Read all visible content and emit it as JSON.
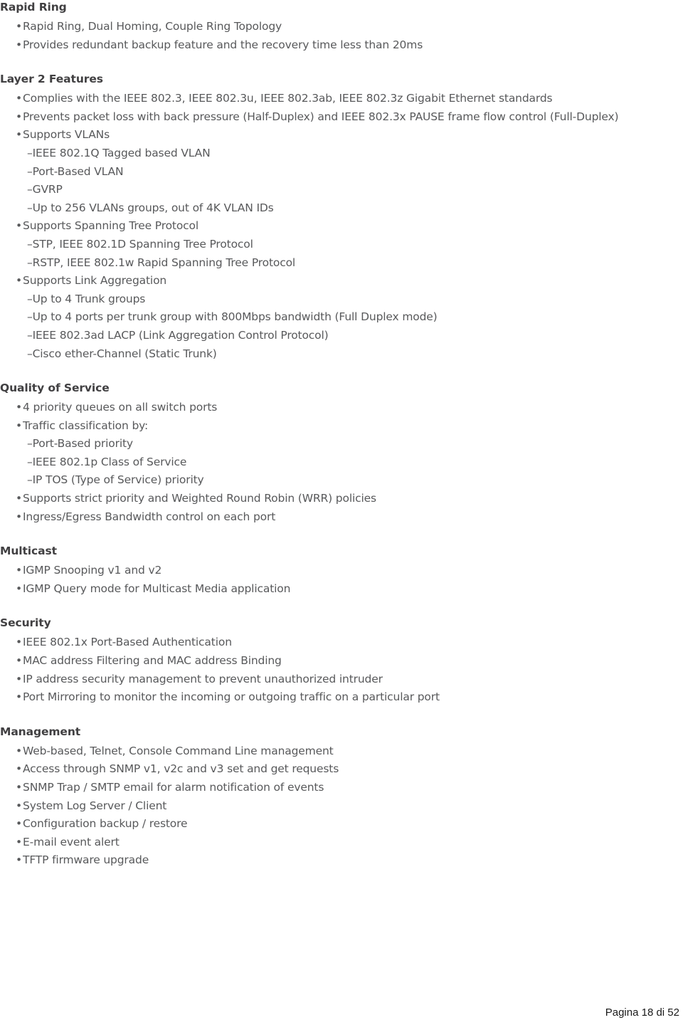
{
  "page": {
    "background_color": "#ffffff",
    "heading_color": "#414042",
    "body_color": "#58595b",
    "footer_color": "#1a1a1a",
    "bullet_glyph": "•",
    "subitem_dash": "–"
  },
  "sections": [
    {
      "heading": "Rapid Ring",
      "items": [
        {
          "text": "Rapid Ring, Dual Homing, Couple Ring Topology",
          "subitems": []
        },
        {
          "text": "Provides redundant backup feature and the recovery time less than 20ms",
          "subitems": []
        }
      ]
    },
    {
      "heading": "Layer 2 Features",
      "items": [
        {
          "text": "Complies with the IEEE 802.3, IEEE 802.3u, IEEE 802.3ab, IEEE 802.3z Gigabit Ethernet standards",
          "subitems": []
        },
        {
          "text": "Prevents packet loss with back pressure (Half-Duplex) and IEEE 802.3x PAUSE frame flow control (Full-Duplex)",
          "subitems": []
        },
        {
          "text": "Supports VLANs",
          "subitems": [
            "–IEEE 802.1Q Tagged based VLAN",
            "–Port-Based VLAN",
            "–GVRP",
            "–Up to 256 VLANs groups, out of 4K VLAN IDs"
          ]
        },
        {
          "text": "Supports Spanning Tree Protocol",
          "subitems": [
            "–STP, IEEE 802.1D Spanning Tree Protocol",
            "–RSTP, IEEE 802.1w Rapid Spanning Tree Protocol"
          ]
        },
        {
          "text": "Supports Link Aggregation",
          "subitems": [
            "–Up to 4 Trunk groups",
            "–Up to 4 ports per trunk group with 800Mbps bandwidth (Full Duplex mode)",
            "–IEEE 802.3ad LACP (Link Aggregation Control Protocol)",
            "–Cisco ether-Channel (Static Trunk)"
          ]
        }
      ]
    },
    {
      "heading": "Quality of Service",
      "items": [
        {
          "text": "4 priority queues on all switch ports",
          "subitems": []
        },
        {
          "text": "Traffic classification by:",
          "subitems": [
            "–Port-Based priority",
            "–IEEE 802.1p Class of Service",
            "–IP TOS (Type of Service) priority"
          ]
        },
        {
          "text": "Supports strict priority and Weighted Round Robin (WRR) policies",
          "subitems": []
        },
        {
          "text": "Ingress/Egress Bandwidth control on each port",
          "subitems": []
        }
      ]
    },
    {
      "heading": "Multicast",
      "items": [
        {
          "text": "IGMP Snooping v1 and v2",
          "subitems": []
        },
        {
          "text": "IGMP Query mode for Multicast Media application",
          "subitems": []
        }
      ]
    },
    {
      "heading": "Security",
      "items": [
        {
          "text": "IEEE 802.1x Port-Based Authentication",
          "subitems": []
        },
        {
          "text": "MAC address Filtering and MAC address Binding",
          "subitems": []
        },
        {
          "text": "IP address security management to prevent unauthorized intruder",
          "subitems": []
        },
        {
          "text": "Port Mirroring to monitor the incoming or outgoing traffic on a particular port",
          "subitems": []
        }
      ]
    },
    {
      "heading": "Management",
      "items": [
        {
          "text": "Web-based, Telnet, Console Command Line management",
          "subitems": []
        },
        {
          "text": "Access through SNMP v1, v2c and v3 set and get requests",
          "subitems": []
        },
        {
          "text": "SNMP Trap / SMTP email for alarm notification of events",
          "subitems": []
        },
        {
          "text": "System Log Server / Client",
          "subitems": []
        },
        {
          "text": "Configuration backup / restore",
          "subitems": []
        },
        {
          "text": "E-mail event alert",
          "subitems": []
        },
        {
          "text": "TFTP firmware upgrade",
          "subitems": []
        }
      ]
    }
  ],
  "footer": {
    "page_label": "Pagina 18 di 52"
  }
}
